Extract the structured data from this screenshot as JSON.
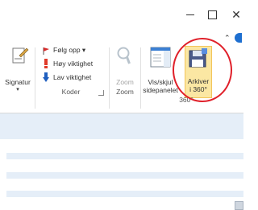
{
  "window": {
    "minimize_glyph": "—",
    "maximize_glyph": "☐",
    "close_glyph": "✕"
  },
  "ribbon": {
    "signature": {
      "label": "Signatur",
      "dropdown": "▾"
    },
    "tags": {
      "follow_up": "Følg opp ▾",
      "high_importance": "Høy viktighet",
      "low_importance": "Lav viktighet",
      "group_label": "Koder"
    },
    "zoom": {
      "label": "Zoom",
      "group_label": "Zoom"
    },
    "show_hide": {
      "label_line1": "Vis/skjul",
      "label_line2": "sidepanelet"
    },
    "archive": {
      "label_line1": "Arkiver",
      "label_line2": "i 360°"
    },
    "group_360_label": "360°"
  },
  "colors": {
    "follow_up_flag": "#d62b2b",
    "high_importance": "#e03a2a",
    "low_importance": "#1f5fbf",
    "highlight_ring": "#e0202a",
    "archive_bg": "#fbe7a3"
  },
  "icons": {
    "signature": "signature-icon",
    "follow_up": "flag-icon",
    "high_importance": "exclamation-icon",
    "low_importance": "down-arrow-icon",
    "zoom": "magnifier-icon",
    "show_hide": "sidebar-panel-icon",
    "archive": "floppy-disk-icon"
  }
}
